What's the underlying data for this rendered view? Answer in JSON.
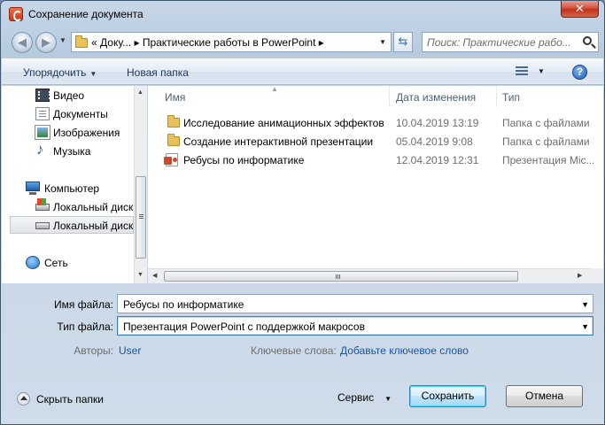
{
  "window": {
    "title": "Сохранение документа",
    "close_glyph": "✕"
  },
  "address": {
    "back_glyph": "◀",
    "forward_glyph": "▶",
    "breadcrumb": "« Доку... ▸ Практические работы в PowerPoint ▸",
    "search_placeholder": "Поиск: Практические рабо..."
  },
  "toolbar": {
    "organize": "Упорядочить",
    "new_folder": "Новая папка",
    "help": "?"
  },
  "sidebar": {
    "items": [
      {
        "label": "Видео",
        "icon": "video-icon"
      },
      {
        "label": "Документы",
        "icon": "documents-icon"
      },
      {
        "label": "Изображения",
        "icon": "pictures-icon"
      },
      {
        "label": "Музыка",
        "icon": "music-icon"
      },
      {
        "label": "Компьютер",
        "icon": "computer-icon"
      },
      {
        "label": "Локальный диск",
        "icon": "system-disk-icon"
      },
      {
        "label": "Локальный диск",
        "icon": "disk-icon",
        "selected": true
      },
      {
        "label": "Сеть",
        "icon": "network-icon"
      }
    ]
  },
  "files": {
    "columns": [
      "Имя",
      "Дата изменения",
      "Тип"
    ],
    "rows": [
      {
        "name": "Исследование анимационных эффектов",
        "date": "10.04.2019 13:19",
        "type": "Папка с файлами",
        "icon": "folder-icon"
      },
      {
        "name": "Создание интерактивной презентации",
        "date": "05.04.2019 9:08",
        "type": "Папка с файлами",
        "icon": "folder-icon"
      },
      {
        "name": "Ребусы по информатике",
        "date": "12.04.2019 12:31",
        "type": "Презентация Mic...",
        "icon": "powerpoint-file-icon"
      }
    ]
  },
  "form": {
    "filename_label": "Имя файла:",
    "filename_value": "Ребусы по информатике",
    "filetype_label": "Тип файла:",
    "filetype_value": "Презентация PowerPoint с поддержкой макросов",
    "authors_label": "Авторы:",
    "authors_value": "User",
    "keywords_label": "Ключевые слова:",
    "keywords_value": "Добавьте ключевое слово"
  },
  "footer": {
    "hide_folders": "Скрыть папки",
    "service": "Сервис",
    "save": "Сохранить",
    "cancel": "Отмена"
  },
  "colors": {
    "title_gradient_top": "#c7d7e8",
    "accent_link": "#1c55a3",
    "close_red": "#c0301a"
  }
}
